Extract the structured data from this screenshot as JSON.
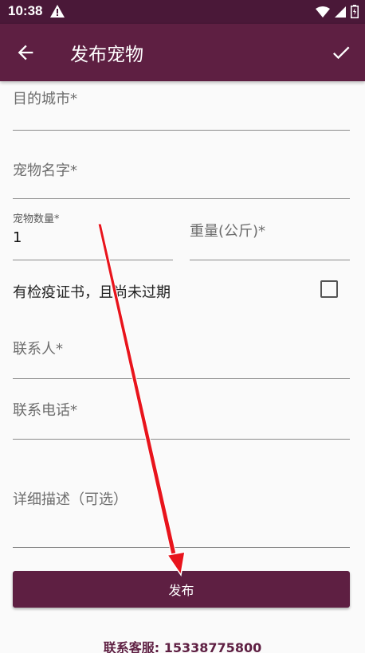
{
  "status_bar": {
    "time": "10:38",
    "icons": [
      "warning-icon",
      "wifi-icon",
      "signal-icon",
      "battery-icon"
    ]
  },
  "appbar": {
    "title": "发布宠物",
    "back_icon": "arrow-left-icon",
    "confirm_icon": "check-icon",
    "color": "#5e1f42"
  },
  "form": {
    "city": {
      "hint": "目的城市*",
      "value": ""
    },
    "pet_name": {
      "hint": "宠物名字*",
      "value": ""
    },
    "pet_count": {
      "label": "宠物数量*",
      "value": "1"
    },
    "weight": {
      "hint": "重量(公斤)*",
      "value": ""
    },
    "vaccine": {
      "label": "有检疫证书，且尚未过期",
      "checked": false
    },
    "contact": {
      "hint": "联系人*",
      "value": ""
    },
    "phone": {
      "hint": "联系电话*",
      "value": ""
    },
    "description": {
      "hint": "详细描述（可选）",
      "value": ""
    }
  },
  "submit_label": "发布",
  "service": "联系客服: 15338775800",
  "annotation": {
    "type": "red-arrow",
    "color": "#e8141c"
  }
}
